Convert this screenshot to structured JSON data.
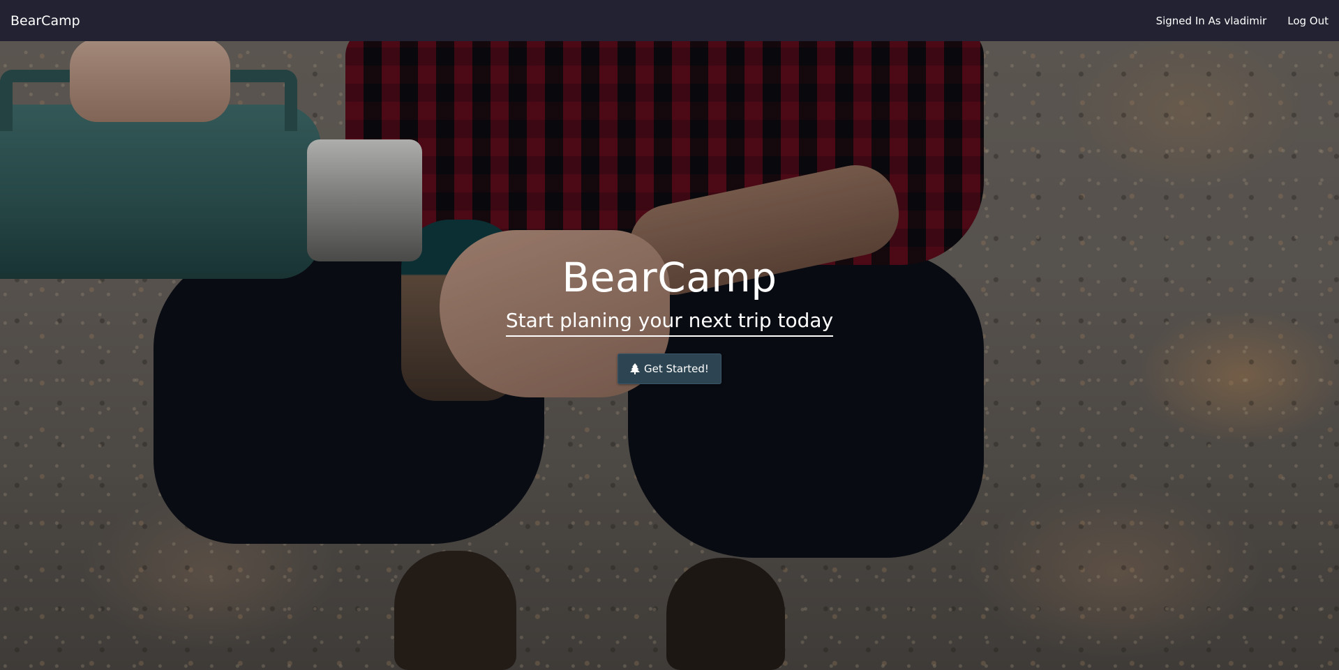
{
  "navbar": {
    "brand": "BearCamp",
    "signed_in_text": "Signed In As vladimir",
    "logout_label": "Log Out"
  },
  "hero": {
    "title": "BearCamp",
    "subtitle": "Start planing your next trip today",
    "cta_label": "Get Started!",
    "cta_icon": "tree-icon"
  },
  "colors": {
    "navbar_bg": "#222232",
    "button_bg": "#2d4452",
    "text": "#ffffff"
  }
}
